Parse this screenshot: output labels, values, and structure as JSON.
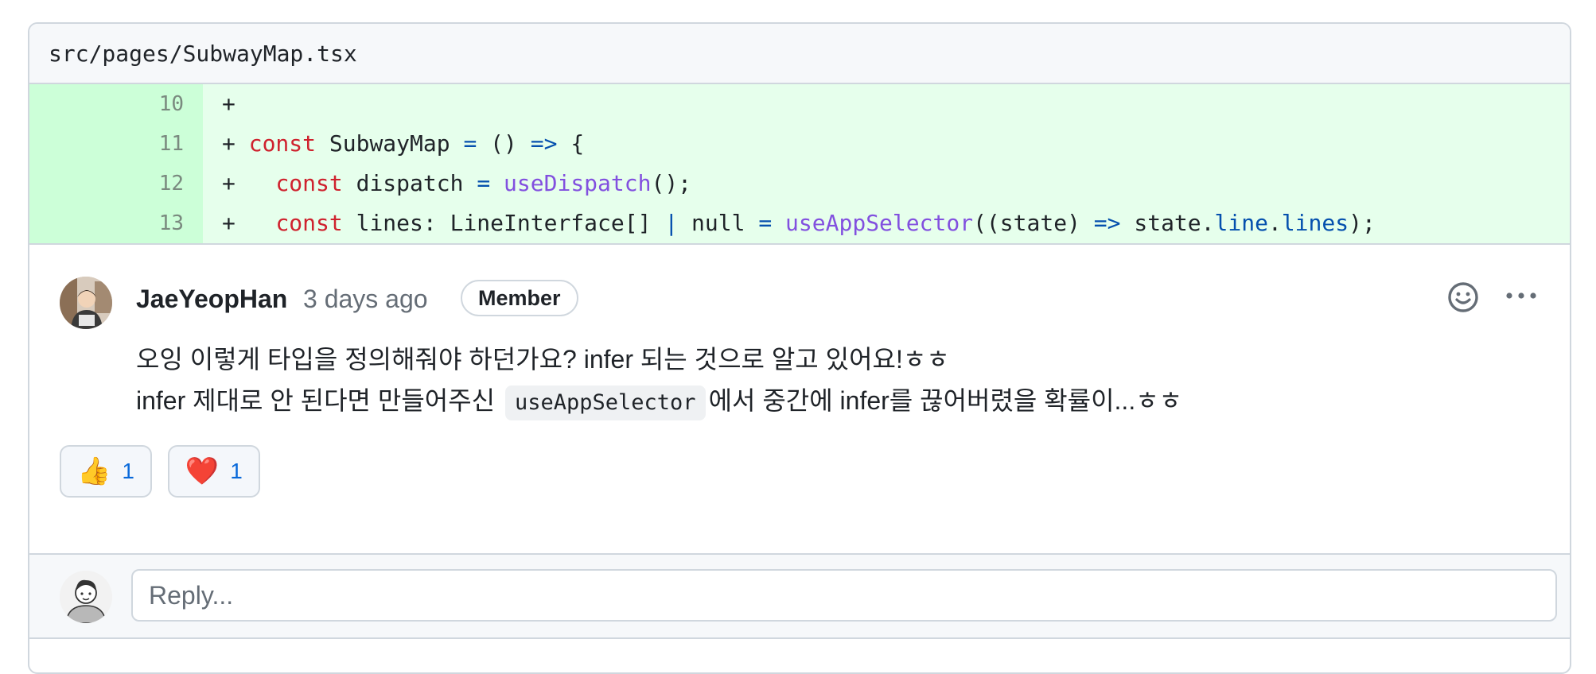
{
  "file": {
    "path": "src/pages/SubwayMap.tsx"
  },
  "diff": {
    "lines": [
      {
        "num": "10",
        "sign": "+",
        "code": ""
      },
      {
        "num": "11",
        "sign": "+",
        "code": "const SubwayMap = () => {"
      },
      {
        "num": "12",
        "sign": "+",
        "code": "  const dispatch = useDispatch();"
      },
      {
        "num": "13",
        "sign": "+",
        "code": "  const lines: LineInterface[] | null = useAppSelector((state) => state.line.lines);"
      }
    ]
  },
  "comment": {
    "author": "JaeYeopHan",
    "time": "3 days ago",
    "badge": "Member",
    "line1": "오잉 이렇게 타입을 정의해줘야 하던가요? infer 되는 것으로 알고 있어요!ㅎㅎ",
    "line2_before": "infer 제대로 안 된다면 만들어주신",
    "line2_code": "useAppSelector",
    "line2_after": "에서 중간에 infer를 끊어버렸을 확률이...ㅎㅎ",
    "reactions": [
      {
        "emoji": "👍",
        "count": "1",
        "icon": "thumbs-up-icon"
      },
      {
        "emoji": "❤️",
        "count": "1",
        "icon": "heart-icon"
      }
    ]
  },
  "reply": {
    "placeholder": "Reply..."
  }
}
